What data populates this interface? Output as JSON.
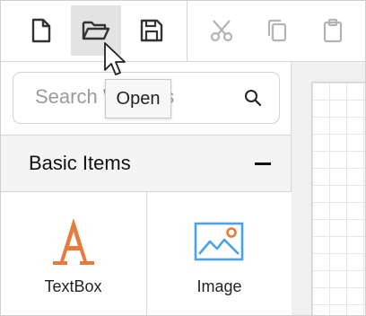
{
  "toolbar": {
    "buttons": [
      {
        "icon": "new-file-icon",
        "state": "enabled"
      },
      {
        "icon": "open-folder-icon",
        "state": "hovered"
      },
      {
        "icon": "save-icon",
        "state": "enabled"
      },
      {
        "icon": "cut-icon",
        "state": "disabled"
      },
      {
        "icon": "copy-icon",
        "state": "disabled"
      },
      {
        "icon": "paste-icon",
        "state": "disabled"
      }
    ],
    "tooltip": "Open"
  },
  "search": {
    "placeholder": "Search Widgets",
    "value": ""
  },
  "section": {
    "title": "Basic Items",
    "collapse_symbol": "–"
  },
  "items": [
    {
      "label": "TextBox",
      "icon": "textbox-icon"
    },
    {
      "label": "Image",
      "icon": "image-icon"
    }
  ],
  "colors": {
    "icon_enabled": "#333333",
    "icon_disabled": "#b3b3b3",
    "textbox_accent": "#e87a3c",
    "image_accent": "#4aa3e8",
    "image_dot": "#e87a3c",
    "hover_bg": "#e3e3e3"
  }
}
